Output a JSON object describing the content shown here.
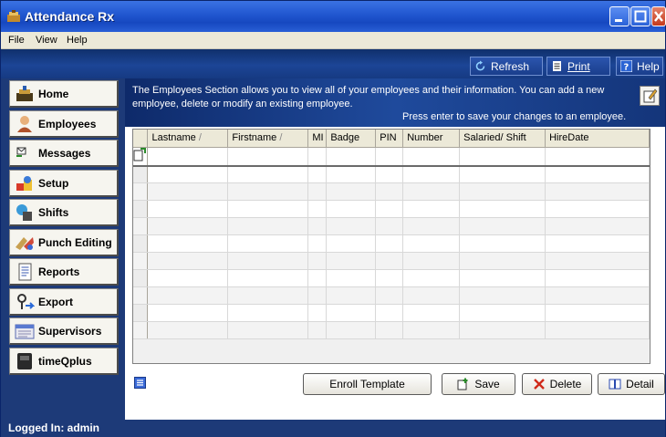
{
  "window": {
    "title": "Attendance Rx"
  },
  "menu": [
    "File",
    "View",
    "Help"
  ],
  "toolbar": {
    "refresh_label": "Refresh",
    "print_label": "Print",
    "help_label": "Help"
  },
  "sidebar": {
    "items": [
      {
        "label": "Home",
        "icon": "home-icon"
      },
      {
        "label": "Employees",
        "icon": "employees-icon"
      },
      {
        "label": "Messages",
        "icon": "messages-icon"
      },
      {
        "label": "Setup",
        "icon": "setup-icon"
      },
      {
        "label": "Shifts",
        "icon": "shifts-icon"
      },
      {
        "label": "Punch Editing",
        "icon": "punch-editing-icon"
      },
      {
        "label": "Reports",
        "icon": "reports-icon"
      },
      {
        "label": "Export",
        "icon": "export-icon"
      },
      {
        "label": "Supervisors",
        "icon": "supervisors-icon"
      },
      {
        "label": "timeQplus",
        "icon": "timeqplus-icon"
      }
    ]
  },
  "info": {
    "text": "The Employees Section allows you to view all of your employees and their information.  You can add a new employee, delete or modify an existing employee.",
    "hint": "Press enter to save your changes to an employee."
  },
  "grid": {
    "columns": [
      "Lastname",
      "Firstname",
      "MI",
      "Badge",
      "PIN",
      "Number",
      "Salaried/ Shift",
      "HireDate"
    ]
  },
  "actions": {
    "enroll_label": "Enroll Template",
    "save_label": "Save",
    "delete_label": "Delete",
    "detail_label": "Detail"
  },
  "status": {
    "logged_in": "Logged In: admin"
  }
}
